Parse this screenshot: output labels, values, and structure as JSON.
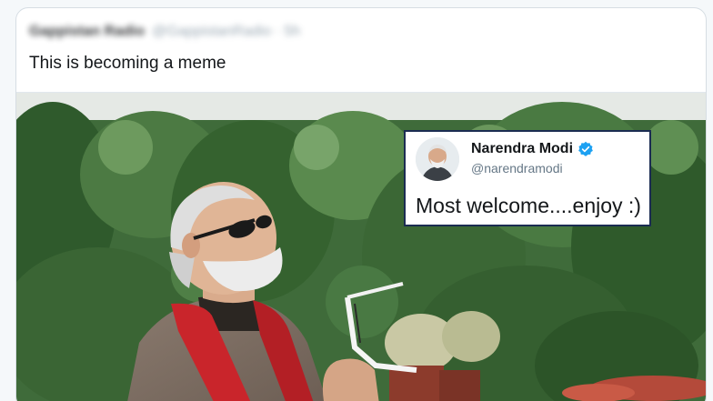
{
  "tweet": {
    "author_name": "Gappistan Radio",
    "author_handle": "@GappistanRadio · 5h",
    "text": "This is becoming a meme"
  },
  "quoted_tweet": {
    "name": "Narendra Modi",
    "handle": "@narendramodi",
    "text": "Most welcome....enjoy :)",
    "verified_icon": "verified-badge-icon"
  },
  "colors": {
    "verified_blue": "#1da1f2",
    "quote_border": "#1b2c52",
    "scarf_red": "#c9252b"
  }
}
